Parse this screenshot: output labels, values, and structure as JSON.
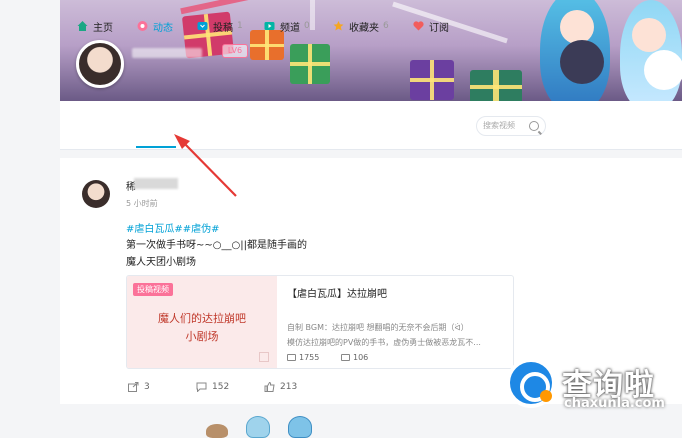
{
  "profile": {
    "level_badge": "LV6"
  },
  "nav": {
    "items": [
      {
        "label": "主页",
        "count": "",
        "icon": "home-icon",
        "color": "#1ba784"
      },
      {
        "label": "动态",
        "count": "",
        "icon": "dynamic-icon",
        "color": "#fb7299",
        "active": true
      },
      {
        "label": "投稿",
        "count": "1",
        "icon": "upload-icon",
        "color": "#00a1d6"
      },
      {
        "label": "频道",
        "count": "0",
        "icon": "channel-icon",
        "color": "#00b5a5"
      },
      {
        "label": "收藏夹",
        "count": "6",
        "icon": "favorite-icon",
        "color": "#f5a623"
      },
      {
        "label": "订阅",
        "count": "",
        "icon": "subscribe-icon",
        "color": "#f25d5d"
      }
    ],
    "search_placeholder": "搜索视频"
  },
  "post": {
    "username_prefix": "稀",
    "time": "5 小时前",
    "tags": "#虐白瓦瓜##虐伪#",
    "text_line1": "第一次做手书呀~~○__○||都是随手画的",
    "text_line2": "魔人天团小剧场",
    "embed": {
      "badge": "投稿视频",
      "thumb_line1": "魔人们的达拉崩吧",
      "thumb_line2": "小剧场",
      "title": "【虐白瓦瓜】达拉崩吧",
      "desc_line1": "自制 BGM：达拉崩吧 想翻唱的无奈不会后期（ᐛ）",
      "desc_line2": "模仿达拉崩吧的PV做的手书，虚伪勇士做被恶龙瓦不...",
      "plays": "1755",
      "danmaku": "106"
    },
    "actions": {
      "share": "3",
      "comment": "152",
      "like": "213"
    }
  },
  "watermark": {
    "text": "查询啦",
    "url": "chaxunla.com"
  },
  "colors": {
    "accent": "#00a1d6",
    "pink": "#fb7299",
    "arrow": "#e53935"
  }
}
